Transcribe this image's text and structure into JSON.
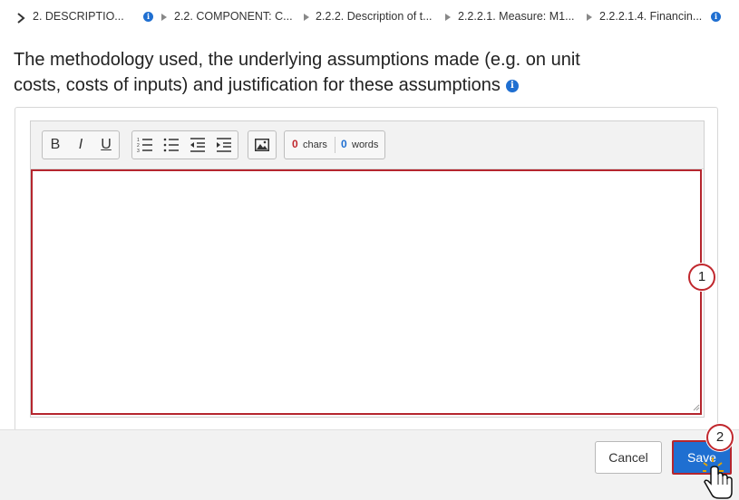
{
  "breadcrumb": {
    "items": [
      "2. DESCRIPTIO...",
      "2.2. COMPONENT: C...",
      "2.2.2. Description of t...",
      "2.2.2.1. Measure: M1...",
      "2.2.2.1.4. Financin..."
    ],
    "toggle_icon": "chevron-right-icon",
    "info_icon": "info-icon"
  },
  "title": {
    "text": "The methodology used, the underlying assumptions made (e.g. on unit costs, costs of inputs) and justification for these assumptions"
  },
  "editor": {
    "toolbar": {
      "bold_label": "B",
      "italic_label": "I",
      "underline_label": "U",
      "icons": [
        "ordered-list-icon",
        "bullet-list-icon",
        "outdent-icon",
        "indent-icon",
        "image-icon"
      ]
    },
    "counter": {
      "chars_value": "0",
      "chars_label": "chars",
      "words_value": "0",
      "words_label": "words"
    },
    "text_value": ""
  },
  "callouts": {
    "one": "1",
    "two": "2"
  },
  "footer": {
    "cancel_label": "Cancel",
    "save_label": "Save"
  },
  "colors": {
    "accent_blue": "#1f6fd1",
    "highlight_red": "#b5262e",
    "chars_red": "#c0272d"
  }
}
